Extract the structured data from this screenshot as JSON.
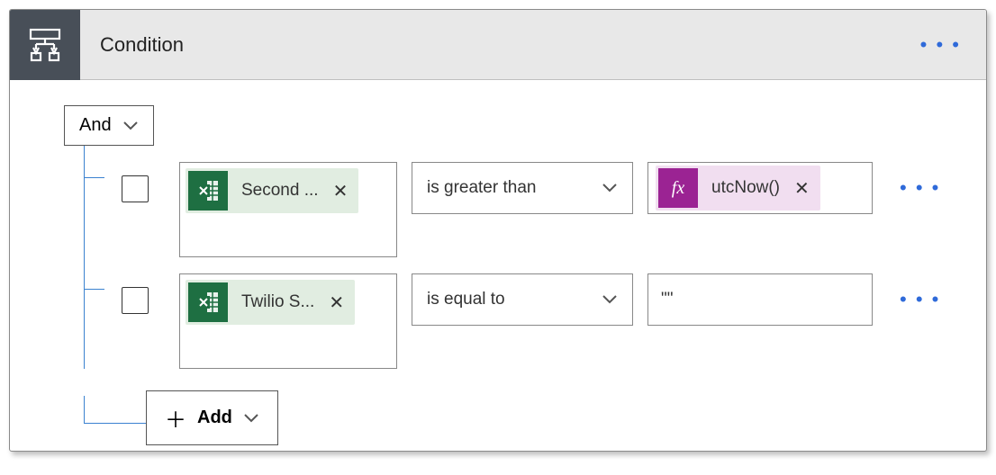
{
  "header": {
    "title": "Condition",
    "menu_label": "…"
  },
  "group": {
    "operator": "And",
    "add_label": "Add"
  },
  "rows": [
    {
      "left_token": {
        "type": "excel",
        "label": "Second ..."
      },
      "operator": "is greater than",
      "right_token": {
        "type": "fx",
        "label": "utcNow()"
      },
      "right_value": null
    },
    {
      "left_token": {
        "type": "excel",
        "label": "Twilio S..."
      },
      "operator": "is equal to",
      "right_token": null,
      "right_value": "\"\""
    }
  ],
  "icons": {
    "fx_glyph": "fx",
    "ellipsis": "• • •"
  }
}
